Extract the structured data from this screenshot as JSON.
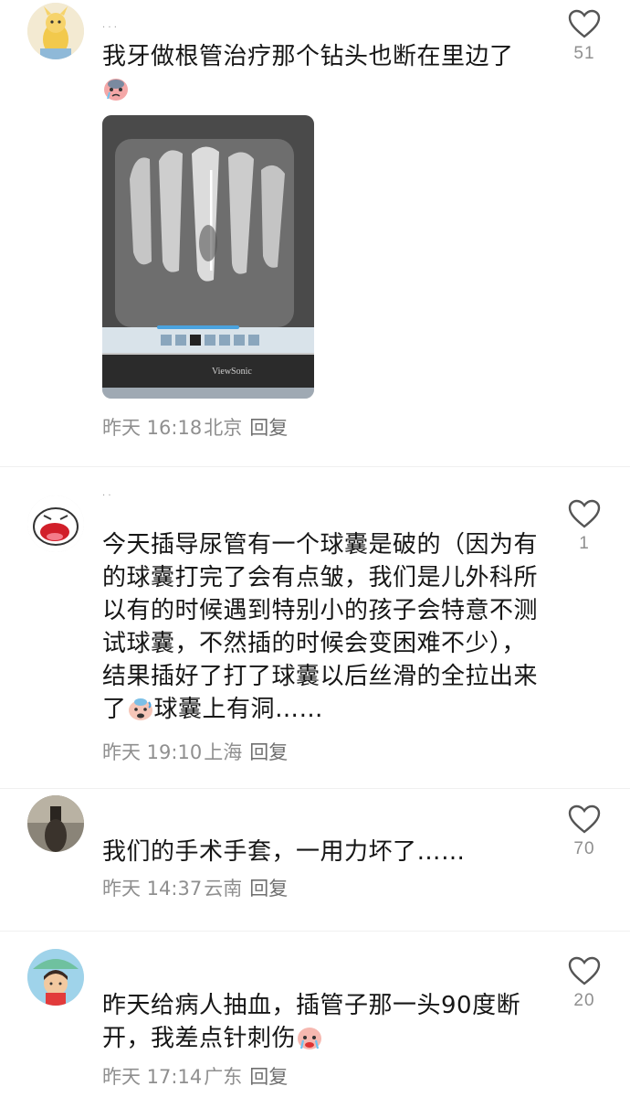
{
  "comments": [
    {
      "username": "· · ·",
      "text": "我牙做根管治疗那个钻头也断在里边了",
      "emoji": "crying-face-emoji",
      "image_label": "ViewSonic",
      "time": "昨天 16:18",
      "location": "北京",
      "reply": "回复",
      "likes": "51"
    },
    {
      "username": "· ·",
      "text_part1": "今天插导尿管有一个球囊是破的（因为有的球囊打完了会有点皱，我们是儿外科所以有的时候遇到特别小的孩子会特意不测试球囊，不然插的时候会变困难不少），结果插好了打了球囊以后丝滑的全拉出来了",
      "text_part2": "球囊上有洞……",
      "emoji": "sweating-face-emoji",
      "time": "昨天 19:10",
      "location": "上海",
      "reply": "回复",
      "likes": "1"
    },
    {
      "text": "我们的手术手套，一用力坏了……",
      "time": "昨天 14:37",
      "location": "云南",
      "reply": "回复",
      "likes": "70"
    },
    {
      "text": "昨天给病人抽血，插管子那一头90度断开，我差点针刺伤",
      "emoji": "crying-face-emoji",
      "time": "昨天 17:14",
      "location": "广东",
      "reply": "回复",
      "likes": "20"
    }
  ]
}
